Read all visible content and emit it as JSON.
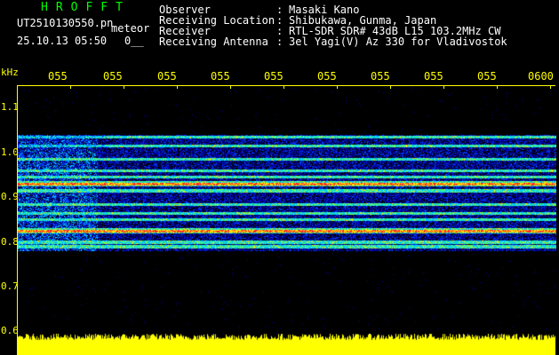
{
  "header": {
    "brand": "HROFFT",
    "file_name": "UT2510130550.pn",
    "mode": "meteor",
    "timestamp": "25.10.13 05:50",
    "extra": "0__",
    "rows": [
      {
        "key": "Observer",
        "value": "Masaki Kano"
      },
      {
        "key": "Receiving Location",
        "value": "Shibukawa, Gunma, Japan"
      },
      {
        "key": "Receiver",
        "value": "RTL-SDR SDR# 43dB L15 103.2MHz CW"
      },
      {
        "key": "Receiving Antenna",
        "value": "3el Yagi(V) Az 330 for Vladivostok"
      }
    ]
  },
  "chart_data": {
    "type": "heatmap",
    "ylabel": "kHz",
    "x_tick_labels": [
      "055",
      "055",
      "055",
      "055",
      "055",
      "055",
      "055",
      "055",
      "055",
      "0600"
    ],
    "y_ticks": [
      {
        "value": 1.1,
        "label": "1.1"
      },
      {
        "value": 1.0,
        "label": "1.0"
      },
      {
        "value": 0.9,
        "label": "0.9"
      },
      {
        "value": 0.8,
        "label": "0.8"
      },
      {
        "value": 0.7,
        "label": "0.7"
      },
      {
        "value": 0.6,
        "label": "0.6"
      }
    ],
    "ylim": [
      0.6,
      1.15
    ],
    "signal_band": [
      0.78,
      1.04
    ],
    "strong_lines_khz": [
      0.93,
      0.825
    ],
    "medium_lines_khz": [
      1.035,
      1.015,
      0.985,
      0.96,
      0.945,
      0.915,
      0.885,
      0.865,
      0.85,
      0.8,
      0.79
    ],
    "colors": {
      "axis": "#ffff00",
      "brand": "#00ff00",
      "text": "#ffffff",
      "background": "#000000",
      "power": "#ffff00"
    }
  }
}
